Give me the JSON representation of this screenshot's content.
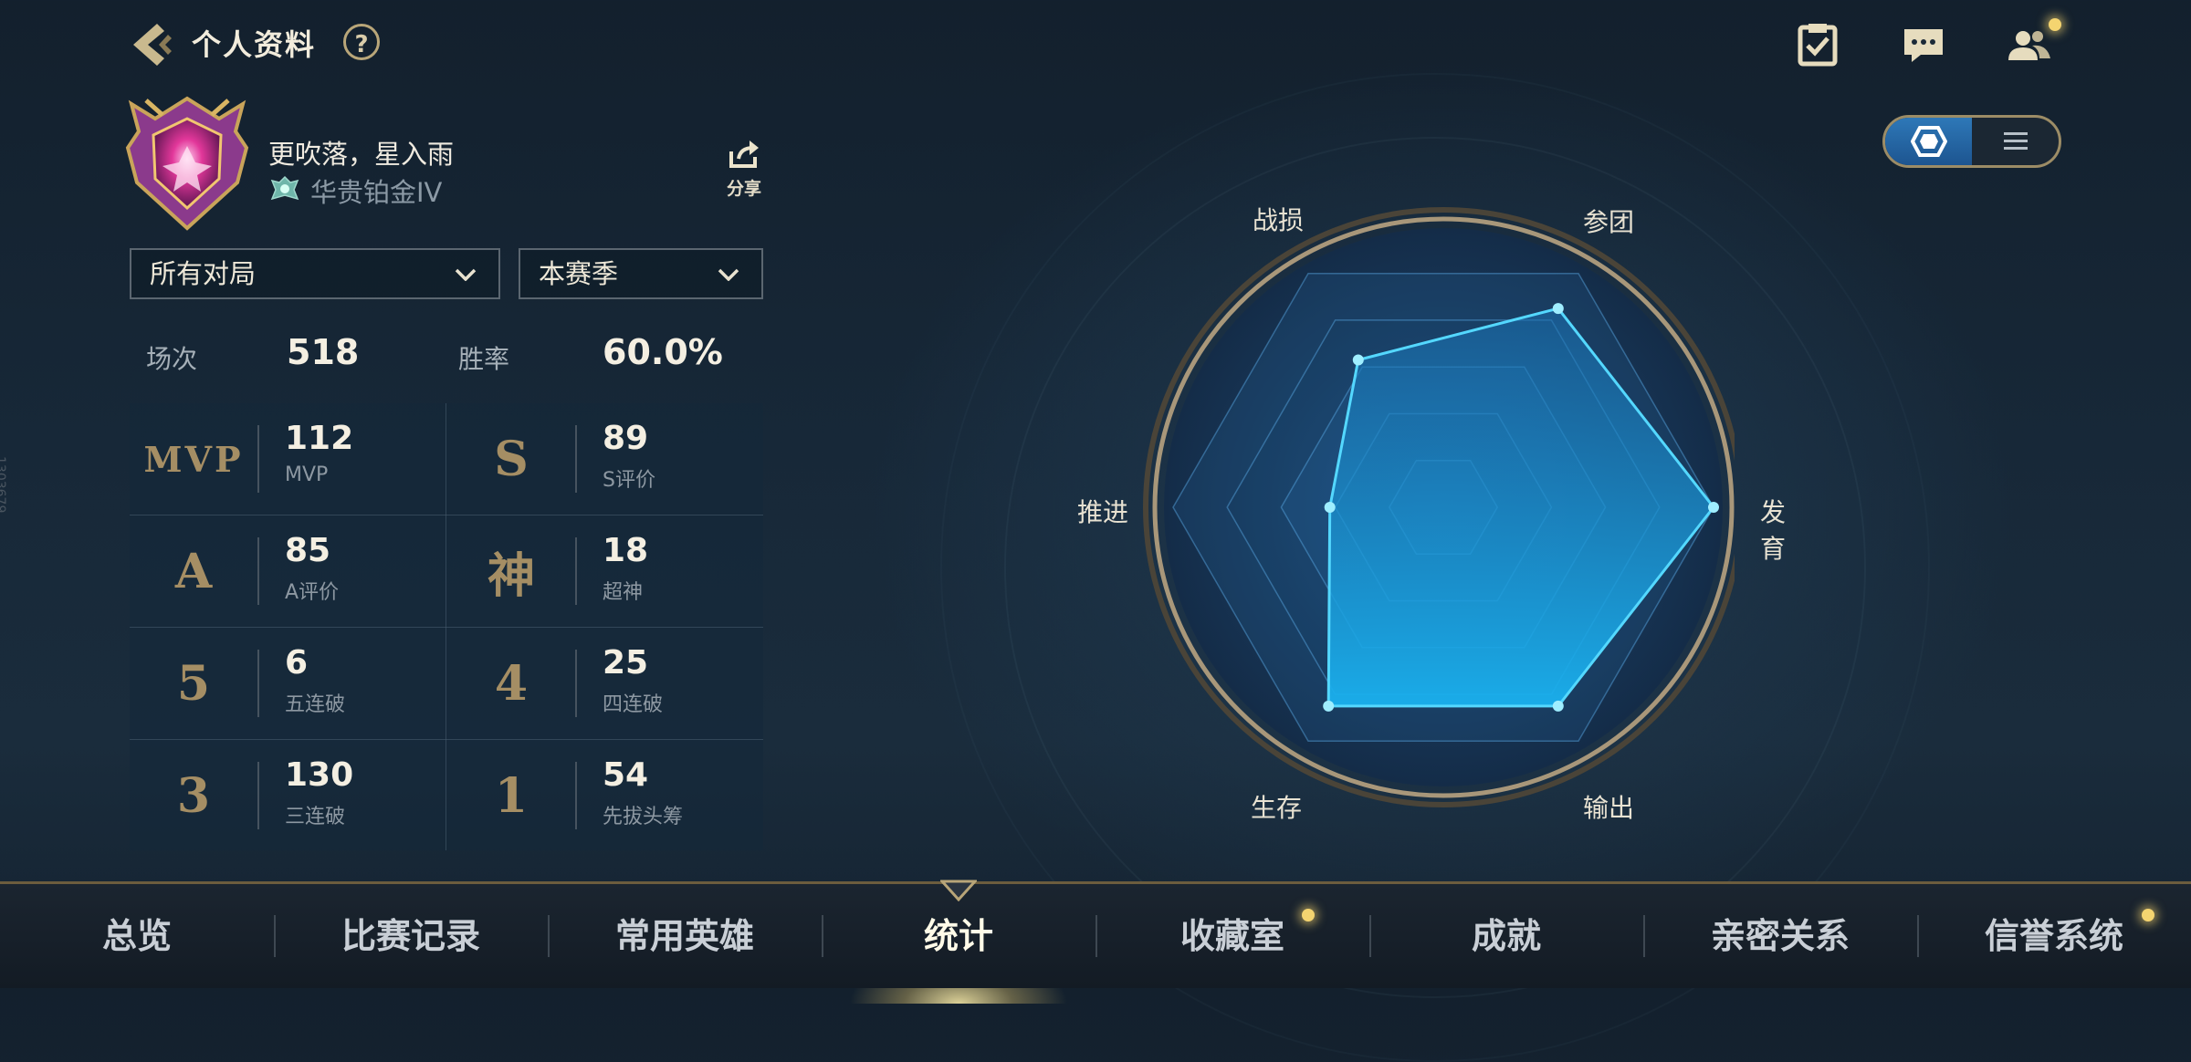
{
  "header": {
    "title": "个人资料",
    "help": "?"
  },
  "profile": {
    "username": "更吹落，星入雨",
    "rank": "华贵铂金IV",
    "share_label": "分享",
    "side_id": "1303679"
  },
  "filters": {
    "mode": "所有对局",
    "season": "本赛季"
  },
  "summary": {
    "matches_label": "场次",
    "matches_value": "518",
    "winrate_label": "胜率",
    "winrate_value": "60.0%"
  },
  "stats": [
    {
      "badge": "MVP",
      "value": "112",
      "label": "MVP"
    },
    {
      "badge": "S",
      "value": "89",
      "label": "S评价"
    },
    {
      "badge": "A",
      "value": "85",
      "label": "A评价"
    },
    {
      "badge": "神",
      "value": "18",
      "label": "超神"
    },
    {
      "badge": "5",
      "value": "6",
      "label": "五连破"
    },
    {
      "badge": "4",
      "value": "25",
      "label": "四连破"
    },
    {
      "badge": "3",
      "value": "130",
      "label": "三连破"
    },
    {
      "badge": "1",
      "value": "54",
      "label": "先拔头筹"
    }
  ],
  "radar": {
    "axes": [
      "战损",
      "参团",
      "发育",
      "输出",
      "生存",
      "推进"
    ],
    "values": [
      0.63,
      0.85,
      1.0,
      0.85,
      0.85,
      0.42
    ],
    "fill_color": "#1aa8e8",
    "line_color": "#54d8ff"
  },
  "nav": {
    "tabs": [
      "总览",
      "比赛记录",
      "常用英雄",
      "统计",
      "收藏室",
      "成就",
      "亲密关系",
      "信誉系统"
    ],
    "active_index": 3
  },
  "colors": {
    "accent_gold": "#b9a679",
    "notification": "#f4d470",
    "toggle_active": "#2e78b8"
  }
}
